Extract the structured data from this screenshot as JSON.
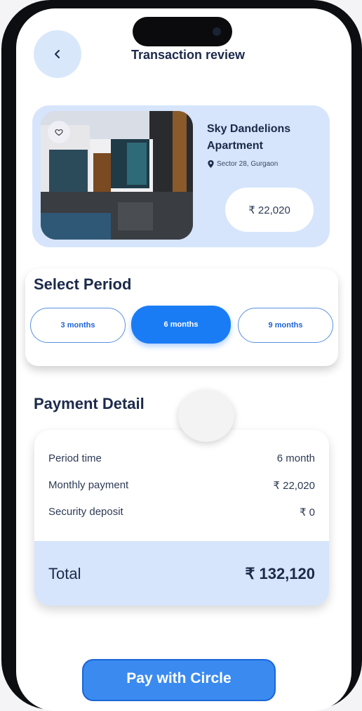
{
  "header": {
    "title": "Transaction review",
    "back_icon": "chevron-left-icon"
  },
  "property": {
    "name": "Sky Dandelions Apartment",
    "location": "Sector 28, Gurgaon",
    "price": "₹ 22,020",
    "favorite_icon": "heart-icon",
    "location_icon": "location-pin-icon"
  },
  "period": {
    "title": "Select Period",
    "options": [
      "3 months",
      "6 months",
      "9 months"
    ],
    "selected": "6 months"
  },
  "payment": {
    "title": "Payment Detail",
    "rows": [
      {
        "label": "Period time",
        "value": "6 month"
      },
      {
        "label": "Monthly payment",
        "value": "₹ 22,020"
      },
      {
        "label": "Security deposit",
        "value": "₹ 0"
      }
    ],
    "total_label": "Total",
    "total_value": "₹ 132,120"
  },
  "cta": {
    "label": "Pay with Circle"
  },
  "colors": {
    "accent": "#1a7cf5",
    "card_bg": "#d6e5fb",
    "text_dark": "#1c2a4a"
  }
}
